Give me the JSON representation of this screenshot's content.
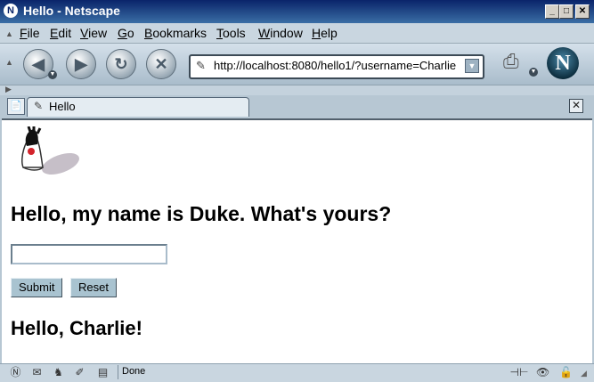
{
  "window": {
    "title": "Hello - Netscape"
  },
  "menu": [
    "File",
    "Edit",
    "View",
    "Go",
    "Bookmarks",
    "Tools",
    "Window",
    "Help"
  ],
  "nav": {
    "back_icon": "back-arrow-icon",
    "forward_icon": "forward-arrow-icon",
    "reload_icon": "reload-icon",
    "stop_icon": "stop-icon",
    "url": "http://localhost:8080/hello1/?username=Charlie"
  },
  "tab": {
    "label": "Hello"
  },
  "page": {
    "heading": "Hello, my name is Duke. What's yours?",
    "input_value": "",
    "submit_label": "Submit",
    "reset_label": "Reset",
    "greeting": "Hello, Charlie!"
  },
  "status": {
    "text": "Done"
  },
  "colors": {
    "chrome": "#b7c7d3",
    "titlebar": "#0a246a",
    "button": "#a9c3d0"
  }
}
